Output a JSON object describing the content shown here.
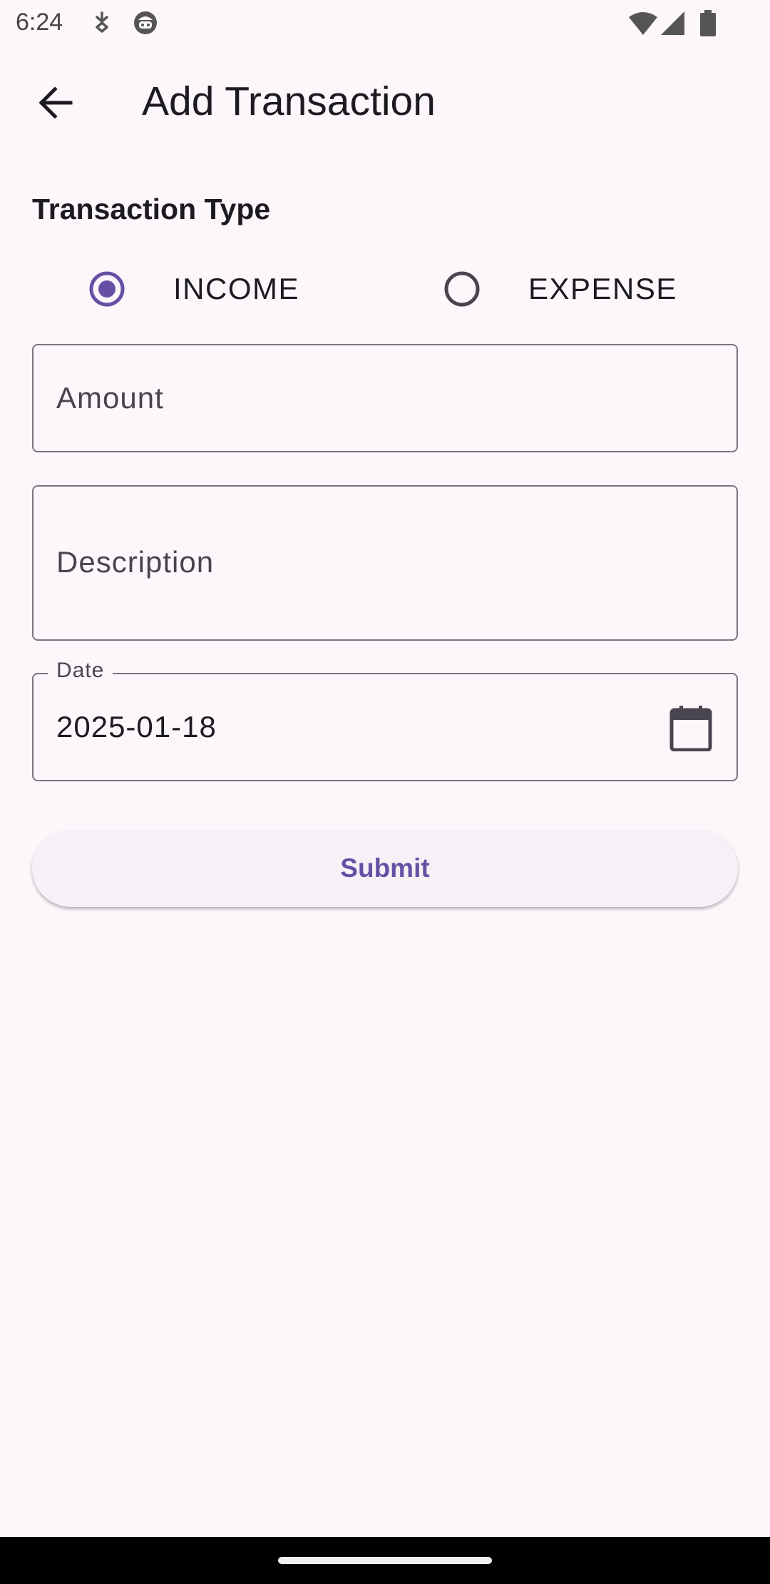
{
  "status_bar": {
    "time": "6:24",
    "icons": [
      "usb-debug-icon",
      "notification-face-icon",
      "wifi-icon",
      "signal-icon",
      "battery-icon"
    ]
  },
  "app_bar": {
    "back_icon": "arrow-back-icon",
    "title": "Add Transaction"
  },
  "form": {
    "transaction_type_label": "Transaction Type",
    "transaction_types": [
      {
        "label": "INCOME",
        "selected": true
      },
      {
        "label": "EXPENSE",
        "selected": false
      }
    ],
    "amount": {
      "placeholder": "Amount",
      "value": ""
    },
    "description": {
      "placeholder": "Description",
      "value": ""
    },
    "date": {
      "label": "Date",
      "value": "2025-01-18",
      "icon": "calendar-icon"
    },
    "submit_label": "Submit"
  },
  "colors": {
    "background": "#FDF7FC",
    "accent": "#6750A4",
    "outline": "#79747E",
    "text_primary": "#1C1B1F",
    "text_secondary": "#49454F"
  }
}
